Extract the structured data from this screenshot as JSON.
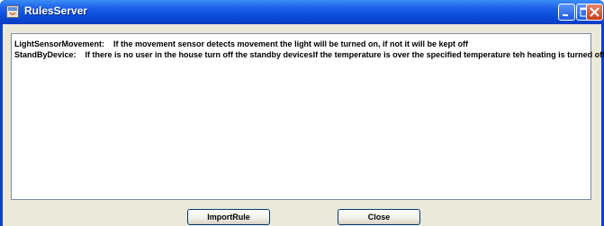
{
  "window": {
    "title": "RulesServer",
    "icon": "java-app-icon",
    "controls": [
      "minimize-icon",
      "maximize-icon",
      "close-icon"
    ],
    "colors": {
      "titlebar": "#0a49d8",
      "client": "#ece9d8",
      "close": "#c63d1a"
    }
  },
  "rules_text": {
    "lines": [
      "LightSensorMovement:    If the movement sensor detects movement the light will be turned on, if not it will be kept off",
      "StandByDevice:    If there is no user in the house turn off the standby devicesIf the temperature is over the specified temperature teh heating is turned off"
    ]
  },
  "buttons": {
    "import_label": "ImportRule",
    "close_label": "Close"
  }
}
